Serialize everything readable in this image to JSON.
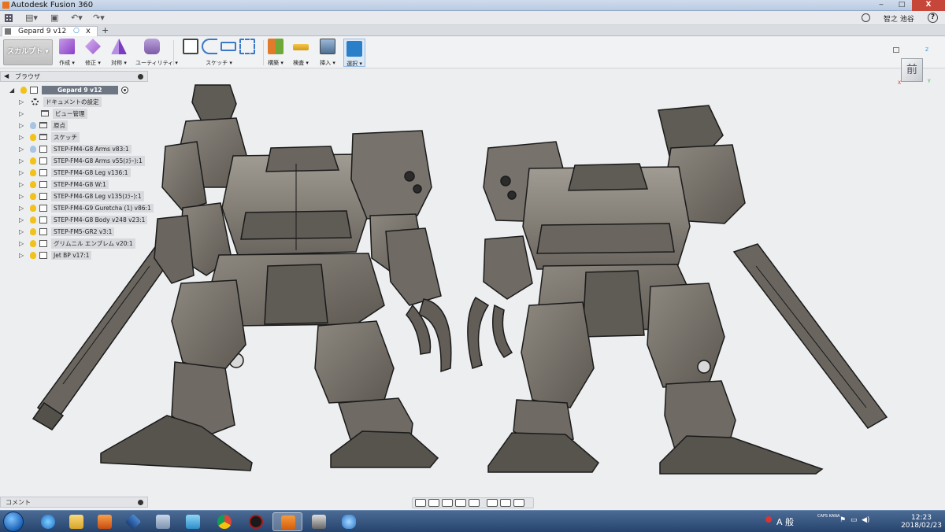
{
  "window": {
    "title": "Autodesk Fusion 360",
    "user_name": "智之 池谷",
    "help_label": "?",
    "close_label": "X"
  },
  "tab": {
    "name": "Gepard 9 v12",
    "close_label": "x",
    "new_tab_label": "+"
  },
  "ribbon": {
    "workspace": "スカルプト ▾",
    "groups": [
      {
        "label": "作成 ▾"
      },
      {
        "label": "修正 ▾"
      },
      {
        "label": "対称 ▾"
      },
      {
        "label": "ユーティリティ ▾"
      },
      {
        "label": "スケッチ ▾"
      },
      {
        "label": "構築 ▾"
      },
      {
        "label": "検査 ▾"
      },
      {
        "label": "挿入 ▾"
      },
      {
        "label": "選択 ▾"
      }
    ]
  },
  "browser": {
    "title": "ブラウザ",
    "root": "Gepard 9 v12",
    "items": [
      {
        "label": "ドキュメントの設定",
        "icon": "gear"
      },
      {
        "label": "ビュー管理",
        "icon": "folder"
      },
      {
        "label": "原点",
        "icon": "folder"
      },
      {
        "label": "スケッチ",
        "icon": "folder"
      },
      {
        "label": "STEP-FM4-G8 Arms v83:1",
        "icon": "component"
      },
      {
        "label": "STEP-FM4-G8 Arms v55(ｽﾗｰ):1",
        "icon": "component"
      },
      {
        "label": "STEP-FM4-G8 Leg v136:1",
        "icon": "component"
      },
      {
        "label": "STEP-FM4-G8 W:1",
        "icon": "component"
      },
      {
        "label": "STEP-FM4-G8 Leg v135(ｽﾗｰ):1",
        "icon": "component"
      },
      {
        "label": "STEP-FM4-G9 Guretcha (1) v86:1",
        "icon": "component"
      },
      {
        "label": "STEP-FM4-G8 Body v248 v23:1",
        "icon": "component"
      },
      {
        "label": "STEP-FM5-GR2 v3:1",
        "icon": "component"
      },
      {
        "label": "グリムニル エンブレム v20:1",
        "icon": "component"
      },
      {
        "label": "Jet BP v17:1",
        "icon": "component"
      }
    ]
  },
  "viewcube": {
    "face_label": "前",
    "axis_x": "X",
    "axis_y": "Y",
    "axis_z": "Z"
  },
  "comments": {
    "title": "コメント"
  },
  "taskbar": {
    "tray_ime": "A 般",
    "tray_caps": "CAPS KANA",
    "time": "12:23",
    "date": "2018/02/23"
  },
  "colors": {
    "accent": "#2a8ad6",
    "canvas_bg": "#eceef0",
    "model_fill": "#77726b",
    "model_edge": "#1b1b1b"
  }
}
